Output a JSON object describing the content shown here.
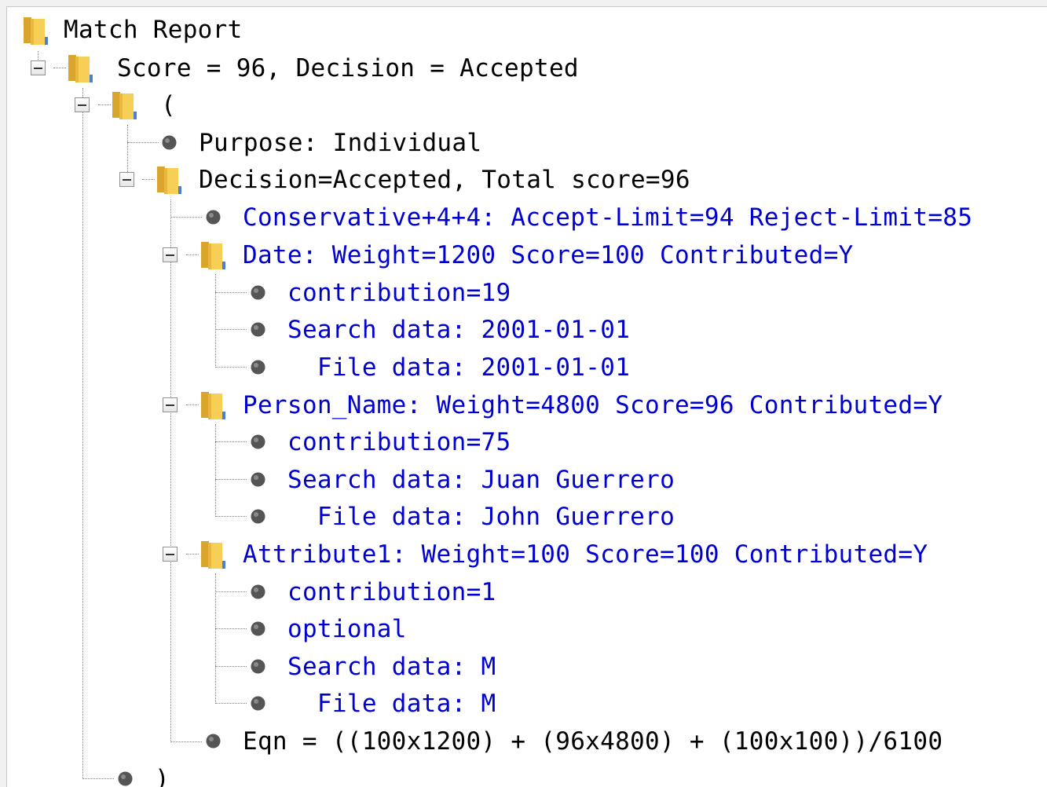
{
  "tree": {
    "root_label": "Match Report",
    "score_node_label": "Score = 96, Decision = Accepted",
    "group_open_label": "(",
    "purpose_label": "Purpose: Individual",
    "decision_label": "Decision=Accepted, Total score=96",
    "limits_label": "Conservative+4+4: Accept-Limit=94 Reject-Limit=85",
    "date": {
      "label": "Date: Weight=1200 Score=100 Contributed=Y",
      "contribution": "contribution=19",
      "search": "Search data: 2001-01-01",
      "file": "  File data: 2001-01-01"
    },
    "person_name": {
      "label": "Person_Name: Weight=4800 Score=96 Contributed=Y",
      "contribution": "contribution=75",
      "search": "Search data: Juan Guerrero",
      "file": "  File data: John Guerrero"
    },
    "attribute1": {
      "label": "Attribute1: Weight=100 Score=100 Contributed=Y",
      "contribution": "contribution=1",
      "optional": "optional",
      "search": "Search data: M",
      "file": "  File data: M"
    },
    "eqn_label": "Eqn = ((100x1200) + (96x4800) + (100x100))/6100",
    "group_close_label": ")"
  },
  "colors": {
    "header_text": "#000000",
    "detail_text": "#0000d0",
    "folder_yellow": "#f5c84c",
    "bullet_gray": "#555555"
  },
  "icons": {
    "folder": "folder-icon",
    "bullet": "bullet-icon",
    "collapse": "minus-box-icon"
  }
}
